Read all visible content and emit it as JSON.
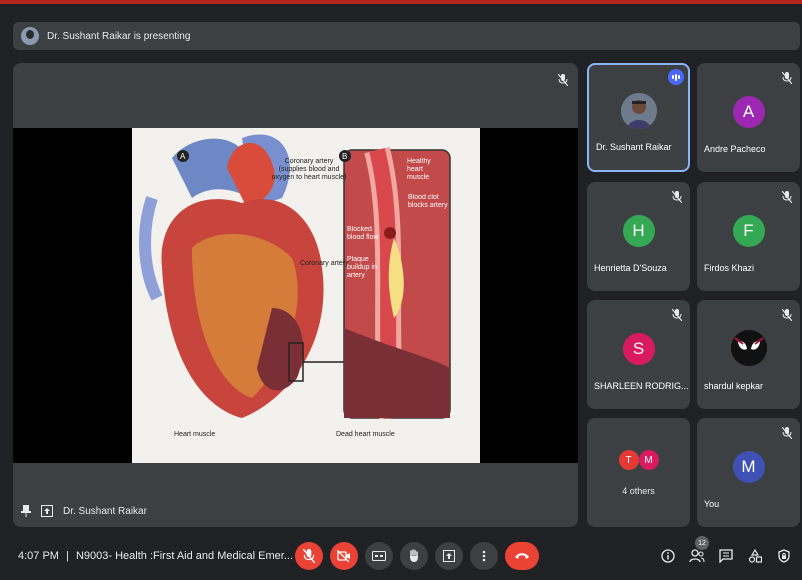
{
  "banner": {
    "text": "Dr. Sushant Raikar is presenting"
  },
  "presentation": {
    "presenter_label": "Dr. Sushant Raikar",
    "slide": {
      "panel_a_label": "A",
      "panel_b_label": "B",
      "coronary_artery_supplies": "Coronary artery (supplies blood and oxygen to heart muscle)",
      "coronary_artery": "Coronary artery",
      "healthy_heart_muscle": "Healthy heart muscle",
      "blood_clot_blocks_artery": "Blood clot blocks artery",
      "blocked_blood_flow": "Blocked blood flow",
      "plaque_buildup": "Plaque buildup in artery",
      "heart_muscle": "Heart muscle",
      "dead_heart_muscle": "Dead heart muscle"
    }
  },
  "participants": [
    {
      "name": "Dr. Sushant Raikar",
      "kind": "photo",
      "speaking": true
    },
    {
      "name": "Andre Pacheco",
      "initial": "A",
      "color": "#9c27b0"
    },
    {
      "name": "Henrietta D'Souza",
      "initial": "H",
      "color": "#34a853"
    },
    {
      "name": "Firdos Khazi",
      "initial": "F",
      "color": "#34a853"
    },
    {
      "name": "SHARLEEN RODRIG...",
      "initial": "S",
      "color": "#d81b60"
    },
    {
      "name": "shardul kepkar",
      "kind": "spider-avatar"
    },
    {
      "others_label": "4 others",
      "initials": [
        "T",
        "M"
      ],
      "colors": [
        "#e53935",
        "#d81b60"
      ]
    },
    {
      "name": "You",
      "initial": "M",
      "color": "#3f51b5"
    }
  ],
  "bottom": {
    "time": "4:07 PM",
    "separator": "|",
    "meeting_title": "N9003- Health :First Aid and Medical Emer...",
    "participants_count": "12"
  },
  "colors": {
    "end_call": "#ea4335",
    "accent": "#8ab4f8"
  }
}
